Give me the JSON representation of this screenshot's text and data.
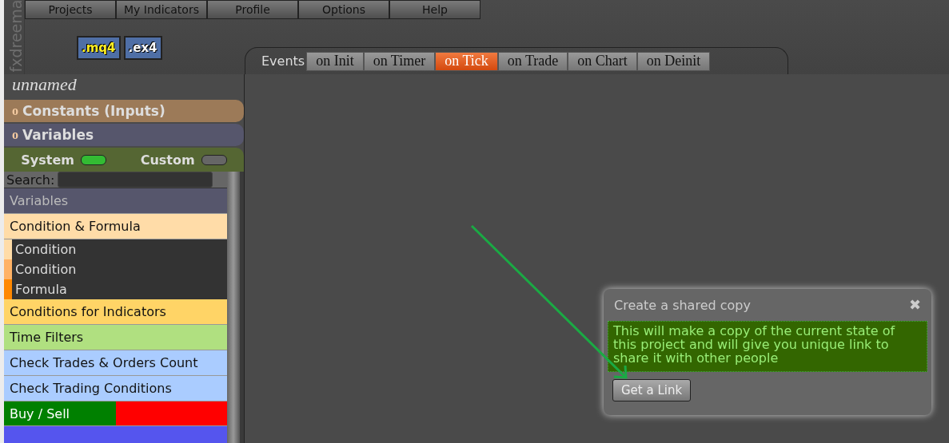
{
  "brand": "fxdreema",
  "menu": [
    "Projects",
    "My Indicators",
    "Profile",
    "Options",
    "Help"
  ],
  "file_buttons": [
    {
      "label": ".mq4",
      "kind": "source"
    },
    {
      "label": ".ex4",
      "kind": "compiled"
    }
  ],
  "project_name": "unnamed",
  "sections": [
    {
      "marker": "o",
      "label": "Constants (Inputs)",
      "color": "#9c7a58"
    },
    {
      "marker": "o",
      "label": "Variables",
      "color": "#56566c"
    }
  ],
  "toggles": [
    {
      "label": "System",
      "on": true
    },
    {
      "label": "Custom",
      "on": false
    }
  ],
  "search": {
    "label": "Search:"
  },
  "blocks": [
    {
      "kind": "header",
      "label": "Variables",
      "color": "#56566c"
    },
    {
      "kind": "category",
      "label": "Condition & Formula",
      "color": "#ffdca8"
    },
    {
      "kind": "sub",
      "label": "Condition",
      "color": "#ffdca8"
    },
    {
      "kind": "sub",
      "label": "Condition",
      "color": "#ffb266"
    },
    {
      "kind": "sub",
      "label": "Formula",
      "color": "#ff8800"
    },
    {
      "kind": "category",
      "label": "Conditions for Indicators",
      "color": "#ffd466"
    },
    {
      "kind": "category",
      "label": "Time Filters",
      "color": "#b0e080"
    },
    {
      "kind": "category",
      "label": "Check Trades & Orders Count",
      "color": "#aaccff"
    },
    {
      "kind": "category",
      "label": "Check Trading Conditions",
      "color": "#aaccff"
    },
    {
      "kind": "split",
      "label": "Buy / Sell",
      "color": "#008000",
      "swatch": {
        "color": "#ff0000"
      }
    },
    {
      "kind": "category",
      "color": "#5555ee"
    }
  ],
  "events": {
    "label": "Events",
    "tabs": [
      {
        "label": "on Init",
        "selected": false
      },
      {
        "label": "on Timer",
        "selected": false
      },
      {
        "label": "on Tick",
        "selected": true
      },
      {
        "label": "on Trade",
        "selected": false
      },
      {
        "label": "on Chart",
        "selected": false
      },
      {
        "label": "on Deinit",
        "selected": false
      }
    ]
  },
  "dialog": {
    "title": "Create a shared copy",
    "close": "✖",
    "message": "This will make a copy of the current state of this project and will give you unique link to share it with other people",
    "button": "Get a Link"
  }
}
